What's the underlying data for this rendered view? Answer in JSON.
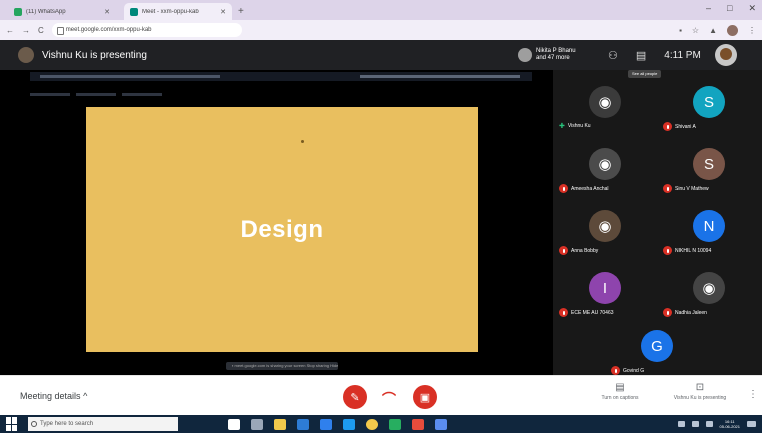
{
  "browser": {
    "tabs": [
      {
        "title": "(11) WhatsApp",
        "active": false
      },
      {
        "title": "Meet - xxm-oppu-kab",
        "active": true
      }
    ],
    "new_tab": "+",
    "window_controls": {
      "minimize": "–",
      "maximize": "□",
      "close": "✕"
    },
    "url": "meet.google.com/xxm-oppu-kab",
    "nav": {
      "back": "←",
      "forward": "→",
      "reload": "C"
    }
  },
  "meet": {
    "presenting_title": "Vishnu Ku is presenting",
    "people_line1": "Nikita P Bhanu",
    "people_line2": "and 47 more",
    "clock": "4:11 PM",
    "pin_hint": "See all people",
    "slide_title": "Design",
    "share_bar_text": "▪ meet.google.com is sharing your screen   Stop sharing   Hide"
  },
  "participants": [
    {
      "name": "Vishnu Ku",
      "initial": "",
      "color": "#3b3b3b",
      "muted": false,
      "photo": true
    },
    {
      "name": "Shivani A",
      "initial": "S",
      "color": "#12a4c0",
      "muted": true,
      "photo": false
    },
    {
      "name": "Ameesha Anchal",
      "initial": "",
      "color": "#4b4b4b",
      "muted": true,
      "photo": true
    },
    {
      "name": "Sinu V Mathew",
      "initial": "S",
      "color": "#795548",
      "muted": true,
      "photo": false
    },
    {
      "name": "Anna Bobby",
      "initial": "",
      "color": "#5d4a3a",
      "muted": true,
      "photo": true
    },
    {
      "name": "NIKHIL N 10094",
      "initial": "N",
      "color": "#1a73e8",
      "muted": true,
      "photo": false
    },
    {
      "name": "ECE ME AU 70463",
      "initial": "I",
      "color": "#8e44ad",
      "muted": true,
      "photo": false
    },
    {
      "name": "Nadhia Jaleen",
      "initial": "",
      "color": "#444",
      "muted": true,
      "photo": true
    },
    {
      "name": "Govind G",
      "initial": "G",
      "color": "#1a73e8",
      "muted": true,
      "photo": false
    }
  ],
  "bottom": {
    "meeting_details": "Meeting details",
    "meeting_details_chevron": "^",
    "captions_label": "Turn on captions",
    "presenting_label": "Vishnu Ku is presenting",
    "more": "⋮"
  },
  "taskbar": {
    "search_placeholder": "Type here to search",
    "time": "16:11",
    "date": "05-06-2021"
  },
  "colors": {
    "accent_red": "#d93025",
    "slide": "#e9bf5f",
    "meet_dark": "#202124"
  }
}
